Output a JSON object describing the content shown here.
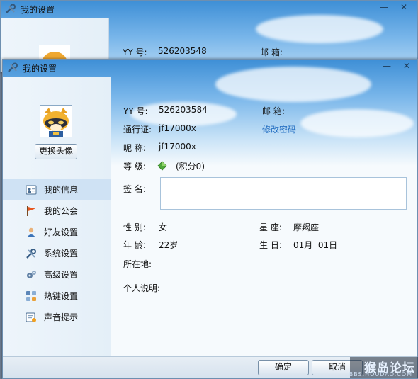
{
  "back_window": {
    "title": "我的设置",
    "yy_label": "YY 号:",
    "yy_value": "526203548",
    "email_label": "邮 箱:"
  },
  "window": {
    "title": "我的设置",
    "minimize": "—",
    "close": "✕"
  },
  "sidebar": {
    "change_avatar": "更换头像",
    "items": [
      {
        "label": "我的信息",
        "icon": "profile-card-icon"
      },
      {
        "label": "我的公会",
        "icon": "flag-icon"
      },
      {
        "label": "好友设置",
        "icon": "person-icon"
      },
      {
        "label": "系统设置",
        "icon": "tools-icon"
      },
      {
        "label": "高级设置",
        "icon": "gears-icon"
      },
      {
        "label": "热键设置",
        "icon": "keyboard-icon"
      },
      {
        "label": "声音提示",
        "icon": "sound-icon"
      }
    ]
  },
  "profile": {
    "yy_label": "YY 号:",
    "yy_value": "526203584",
    "email_label": "邮 箱:",
    "passport_label": "通行证:",
    "passport_value": "jf17000x",
    "change_password": "修改密码",
    "nickname_label": "昵 称:",
    "nickname_value": "jf17000x",
    "level_label": "等 级:",
    "level_points": "(积分0)",
    "signature_label": "签 名:",
    "gender_label": "性 别:",
    "gender_value": "女",
    "zodiac_label": "星 座:",
    "zodiac_value": "摩羯座",
    "age_label": "年 龄:",
    "age_value": "22岁",
    "birthday_label": "生 日:",
    "birthday_value": "01月  01日",
    "location_label": "所在地:",
    "bio_label": "个人说明:"
  },
  "footer": {
    "ok": "确定",
    "cancel": "取消"
  },
  "watermark": {
    "text": "猴岛论坛",
    "url": "BBS.HOUDAO.COM"
  }
}
